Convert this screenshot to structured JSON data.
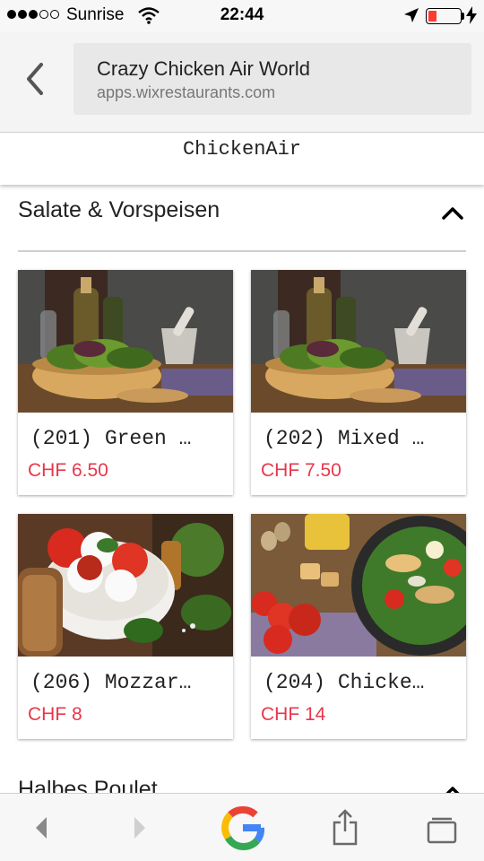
{
  "status_bar": {
    "carrier": "Sunrise",
    "time": "22:44",
    "battery_level": 0.25,
    "battery_color": "#ff3b30",
    "signal_bars": 3,
    "signal_total": 5
  },
  "browser": {
    "page_title": "Crazy Chicken Air World",
    "url": "apps.wixrestaurants.com"
  },
  "restaurant": {
    "name": "ChickenAir"
  },
  "sections": [
    {
      "title": "Salate & Vorspeisen",
      "expanded": true,
      "items": [
        {
          "name": "(201) Green …",
          "price": "CHF 6.50",
          "image": "salad-bowl-photo"
        },
        {
          "name": "(202) Mixed …",
          "price": "CHF 7.50",
          "image": "salad-bowl-photo"
        },
        {
          "name": "(206) Mozzar…",
          "price": "CHF 8",
          "image": "mozzarella-tomato-photo"
        },
        {
          "name": "(204) Chicke…",
          "price": "CHF 14",
          "image": "chicken-caesar-salad-photo"
        }
      ]
    },
    {
      "title": "Halbes Poulet",
      "expanded": true
    }
  ],
  "toolbar": {
    "icons": [
      "back-arrow-icon",
      "forward-arrow-icon",
      "google-icon",
      "share-icon",
      "tabs-icon"
    ]
  },
  "colors": {
    "price": "#e8374b",
    "toolbar_bg": "#f7f7f7",
    "address_bar_bg": "#f4f4f4"
  }
}
